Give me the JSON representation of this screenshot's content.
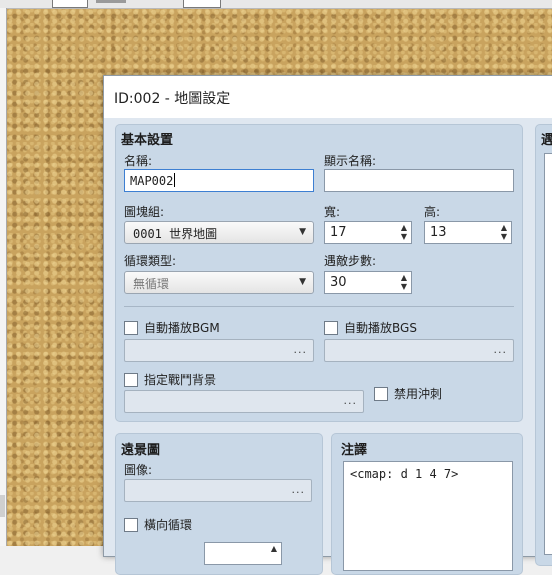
{
  "dialog": {
    "title": "ID:002 - 地圖設定"
  },
  "basic": {
    "title": "基本設置",
    "name_label": "名稱:",
    "name_value": "MAP002",
    "display_name_label": "顯示名稱:",
    "display_name_value": "",
    "tileset_label": "圖塊組:",
    "tileset_value": "0001 世界地圖",
    "width_label": "寬:",
    "width_value": "17",
    "height_label": "高:",
    "height_value": "13",
    "loop_label": "循環類型:",
    "loop_value": "無循環",
    "encounter_label": "遇敵步數:",
    "encounter_value": "30",
    "autoplay_bgm_label": "自動播放BGM",
    "autoplay_bgs_label": "自動播放BGS",
    "battleback_label": "指定戰鬥背景",
    "disable_dash_label": "禁用沖刺",
    "picker_dots": "..."
  },
  "parallax": {
    "title": "遠景圖",
    "image_label": "圖像:",
    "loop_h_label": "橫向循環"
  },
  "note": {
    "title": "注譯",
    "text": "<cmap: d 1 4 7>"
  },
  "right_panel": {
    "title": "遇"
  }
}
